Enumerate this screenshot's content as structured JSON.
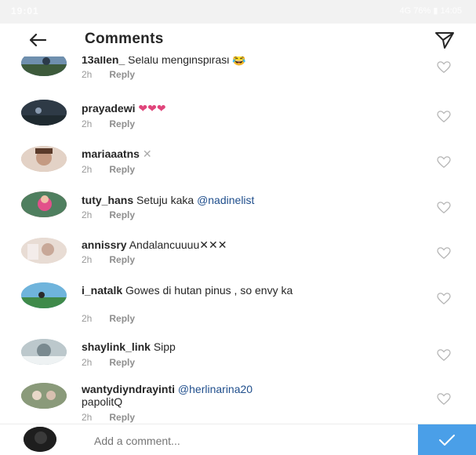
{
  "status_bar": {
    "time": "19:01",
    "right": "4G 76% ▮ 14:05"
  },
  "header": {
    "title": "Comments",
    "back_icon": "arrow-left-icon",
    "send_icon": "paper-plane-icon"
  },
  "colors": {
    "mention": "#1f4e8c",
    "accent": "#4a9fe8",
    "muted": "#999999"
  },
  "comments": [
    {
      "username": "13allen_",
      "text": " Selalu menginspirasi 😂",
      "time": "2h",
      "reply": "Reply",
      "avatar_color": "#4a6b8a"
    },
    {
      "username": "prayadewi",
      "text": " ❤❤❤",
      "time": "2h",
      "reply": "Reply",
      "avatar_color": "#3b4b5a"
    },
    {
      "username": "mariaaatns",
      "text": " ✕",
      "time": "2h",
      "reply": "Reply",
      "avatar_color": "#c9a890"
    },
    {
      "username": "tuty_hans",
      "text": " Setuju kaka ",
      "mention": "@nadinelist",
      "time": "2h",
      "reply": "Reply",
      "avatar_color": "#c0506e"
    },
    {
      "username": "annissry",
      "text": " Andalancuuuu✕✕✕",
      "time": "2h",
      "reply": "Reply",
      "avatar_color": "#d8c3b6"
    },
    {
      "username": "i_natalk",
      "text": " Gowes di hutan pinus , so envy ka",
      "time": "2h",
      "reply": "Reply",
      "avatar_color": "#5fa0c8"
    },
    {
      "username": "shaylink_link",
      "text": " Sipp",
      "time": "2h",
      "reply": "Reply",
      "avatar_color": "#9bb0b8"
    },
    {
      "username": "wantydiyndrayinti",
      "text": " ",
      "mention": "@herlinarina20",
      "text2": " papolitQ",
      "time": "2h",
      "reply": "Reply",
      "avatar_color": "#7a8a6a"
    }
  ],
  "composer": {
    "placeholder": "Add a comment...",
    "avatar_color": "#2a2a2a",
    "send_icon": "checkmark-icon"
  }
}
